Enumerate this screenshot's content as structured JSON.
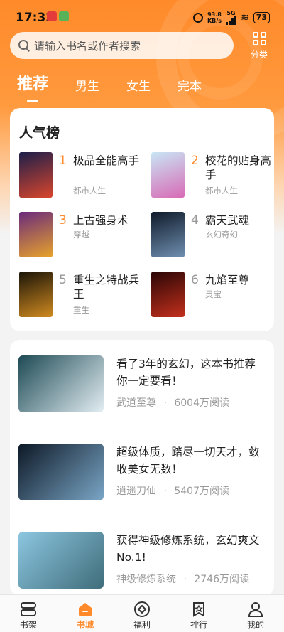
{
  "status_bar": {
    "time": "17:32",
    "net_speed": "93.8",
    "net_unit": "KB/s",
    "signal": "5G",
    "battery": "73"
  },
  "search": {
    "placeholder": "请输入书名或作者搜索"
  },
  "category_label": "分类",
  "tabs": [
    {
      "label": "推荐",
      "active": true
    },
    {
      "label": "男生",
      "active": false
    },
    {
      "label": "女生",
      "active": false
    },
    {
      "label": "完本",
      "active": false
    }
  ],
  "popular": {
    "title": "人气榜",
    "items": [
      {
        "rank": "1",
        "name": "极品全能高手",
        "genre": "都市人生",
        "rank_color": "#ff8a2a",
        "cover_colors": [
          "#1c1f4a",
          "#d9452c"
        ]
      },
      {
        "rank": "2",
        "name": "校花的贴身高手",
        "genre": "都市人生",
        "rank_color": "#ff8a2a",
        "cover_colors": [
          "#c8e6f5",
          "#d86ab5"
        ]
      },
      {
        "rank": "3",
        "name": "上古强身术",
        "genre": "穿越",
        "rank_color": "#ff8a2a",
        "cover_colors": [
          "#6a2a7c",
          "#e8a32a"
        ]
      },
      {
        "rank": "4",
        "name": "霸天武魂",
        "genre": "玄幻奇幻",
        "rank_color": "#999999",
        "cover_colors": [
          "#0f1a2a",
          "#6f8fb0"
        ]
      },
      {
        "rank": "5",
        "name": "重生之特战兵王",
        "genre": "重生",
        "rank_color": "#999999",
        "cover_colors": [
          "#1a1408",
          "#d08a20"
        ]
      },
      {
        "rank": "6",
        "name": "九焰至尊",
        "genre": "灵宝",
        "rank_color": "#999999",
        "cover_colors": [
          "#2a0606",
          "#c3301c"
        ]
      }
    ]
  },
  "feed": [
    {
      "headline": "看了3年的玄幻，这本书推荐你一定要看！",
      "book": "武道至尊",
      "reads": "6004万阅读",
      "thumb_colors": [
        "#1d4a55",
        "#e3eef3"
      ]
    },
    {
      "headline": "超级体质，踏尽一切天才，敛收美女无数！",
      "book": "逍遥刀仙",
      "reads": "5407万阅读",
      "thumb_colors": [
        "#0d1826",
        "#7aa6c6"
      ]
    },
    {
      "headline": "获得神级修炼系统，玄幻爽文No.1!",
      "book": "神级修炼系统",
      "reads": "2746万阅读",
      "thumb_colors": [
        "#8cc6e0",
        "#3f6d7a"
      ]
    }
  ],
  "meta_separator": "·",
  "nav": [
    {
      "label": "书架",
      "icon": "bookshelf-icon",
      "active": false
    },
    {
      "label": "书城",
      "icon": "bookstore-icon",
      "active": true
    },
    {
      "label": "福利",
      "icon": "welfare-icon",
      "active": false
    },
    {
      "label": "排行",
      "icon": "ranking-icon",
      "active": false
    },
    {
      "label": "我的",
      "icon": "profile-icon",
      "active": false
    }
  ],
  "colors": {
    "accent": "#ff8a2a"
  }
}
